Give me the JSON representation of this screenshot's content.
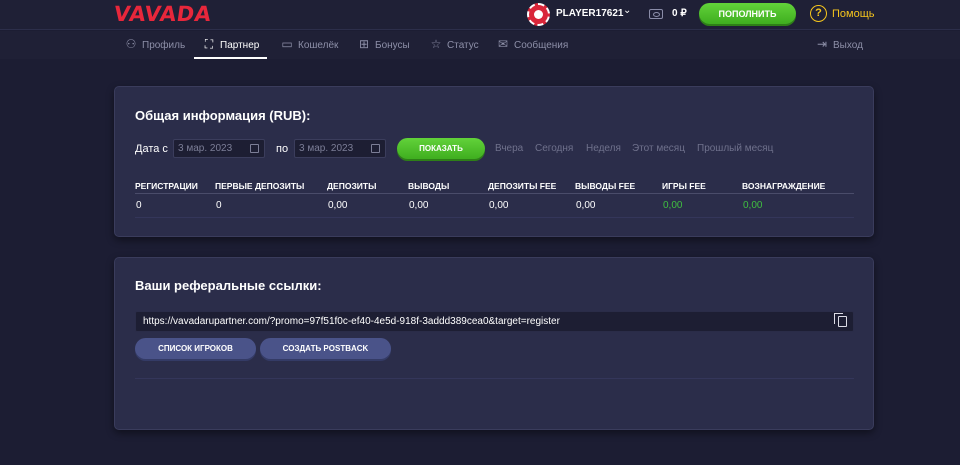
{
  "header": {
    "logo": "VAVADA",
    "username": "PLAYER17621",
    "balance": "0 ₽",
    "deposit_label": "ПОПОЛНИТЬ",
    "help_label": "Помощь"
  },
  "nav": {
    "items": [
      {
        "label": "Профиль",
        "icon": "user-icon"
      },
      {
        "label": "Партнер",
        "icon": "network-icon"
      },
      {
        "label": "Кошелёк",
        "icon": "wallet-icon"
      },
      {
        "label": "Бонусы",
        "icon": "gift-icon"
      },
      {
        "label": "Статус",
        "icon": "star-icon"
      },
      {
        "label": "Сообщения",
        "icon": "mail-icon"
      }
    ],
    "active": "Партнер",
    "logout_label": "Выход"
  },
  "general": {
    "title": "Общая информация (RUB):",
    "date_from_label": "Дата с",
    "date_from_value": "3 мар. 2023",
    "date_to_label": "по",
    "date_to_value": "3 мар. 2023",
    "show_label": "ПОКАЗАТЬ",
    "quick_ranges": [
      "Вчера",
      "Сегодня",
      "Неделя",
      "Этот месяц",
      "Прошлый месяц"
    ],
    "table": {
      "headers": [
        "РЕГИСТРАЦИИ",
        "ПЕРВЫЕ ДЕПОЗИТЫ",
        "ДЕПОЗИТЫ",
        "ВЫВОДЫ",
        "ДЕПОЗИТЫ FEE",
        "ВЫВОДЫ FEE",
        "ИГРЫ FEE",
        "ВОЗНАГРАЖДЕНИЕ"
      ],
      "values": [
        "0",
        "0",
        "0,00",
        "0,00",
        "0,00",
        "0,00",
        "0,00",
        "0,00"
      ]
    }
  },
  "referral": {
    "title": "Ваши реферальные ссылки:",
    "link": "https://vavadarupartner.com/?promo=97f51f0c-ef40-4e5d-918f-3addd389cea0&target=register",
    "players_list_label": "СПИСОК ИГРОКОВ",
    "create_postback_label": "СОЗДАТЬ POSTBACK"
  },
  "colors": {
    "background": "#1c1d33",
    "card": "#2b2d4a",
    "brand_red": "#e8273b",
    "accent_green": "#4cc22b",
    "help_yellow": "#f5c51d",
    "value_green": "#3fbf3f"
  }
}
